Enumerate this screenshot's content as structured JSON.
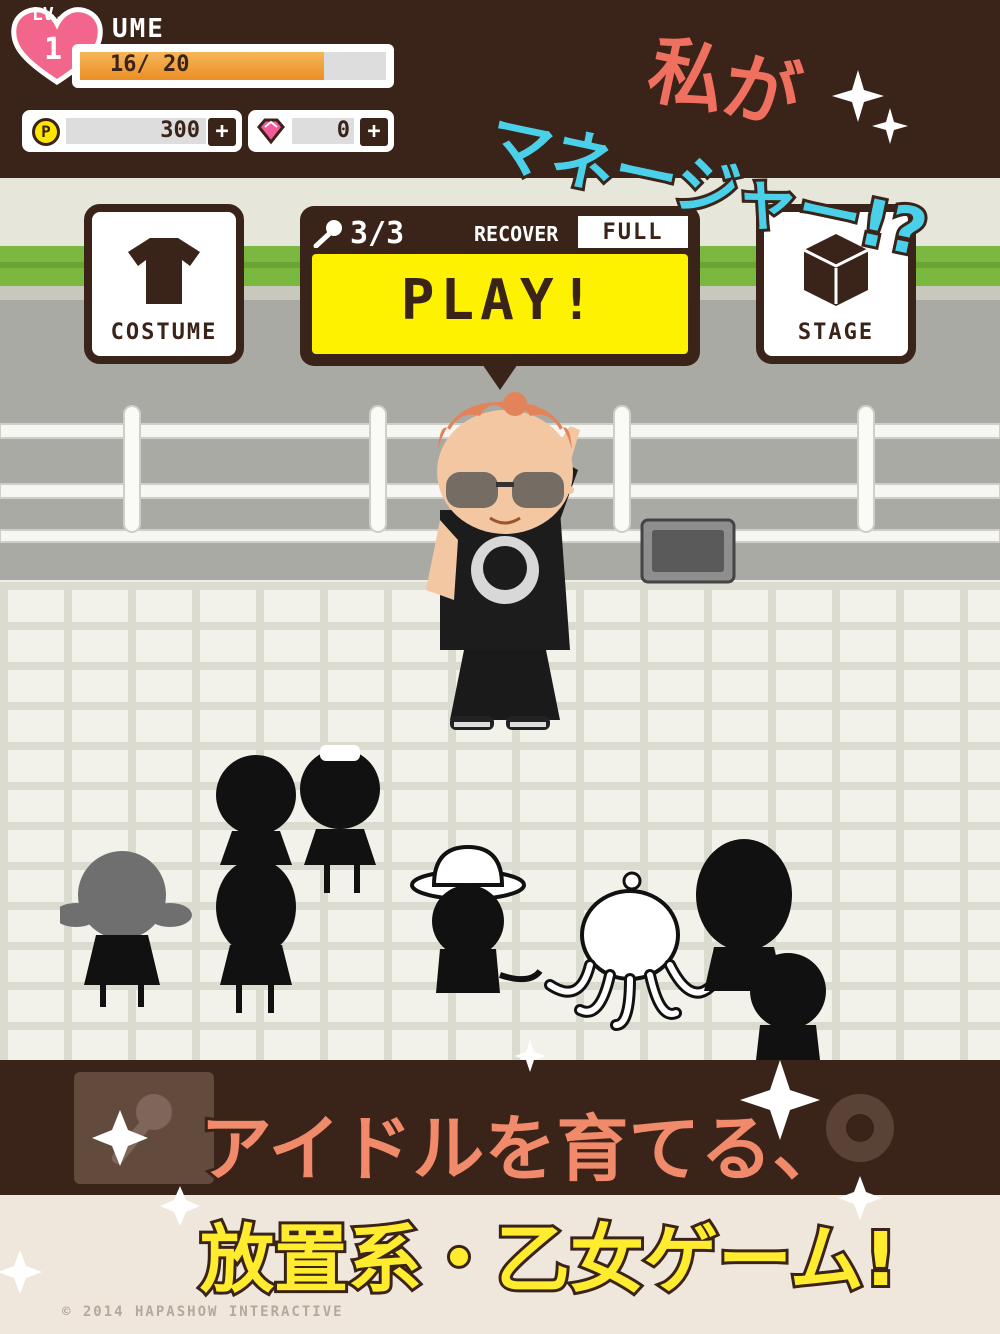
{
  "player": {
    "level_label": "LV.",
    "level": "1",
    "name": "UME",
    "xp_text": "16/ 20",
    "xp_fraction": 0.8
  },
  "currency": {
    "points_icon": "P",
    "points": "300",
    "gems": "0",
    "plus": "+"
  },
  "buttons": {
    "costume": "COSTUME",
    "stage": "STAGE",
    "play": "PLAY!",
    "mic_count": "3/3",
    "recover_label": "RECOVER",
    "recover_status": "FULL"
  },
  "headline": {
    "line1": "私が",
    "line2": "マネージャー!?"
  },
  "tagline": {
    "line1": "アイドルを育てる、",
    "line2": "放置系・乙女ゲーム!"
  },
  "copyright": "© 2014 HAPASHOW INTERACTIVE",
  "colors": {
    "dark_brown": "#3a2318",
    "play_yellow": "#fff200",
    "heart_pink": "#f2668b",
    "headline_cyan": "#4ad0e8",
    "headline_coral": "#f07060",
    "xp_orange": "#ec8e25"
  },
  "icons": {
    "heart": "heart-icon",
    "gem": "gem-icon",
    "tshirt": "tshirt-icon",
    "cube": "cube-icon",
    "mic": "mic-icon",
    "gear": "gear-icon"
  }
}
